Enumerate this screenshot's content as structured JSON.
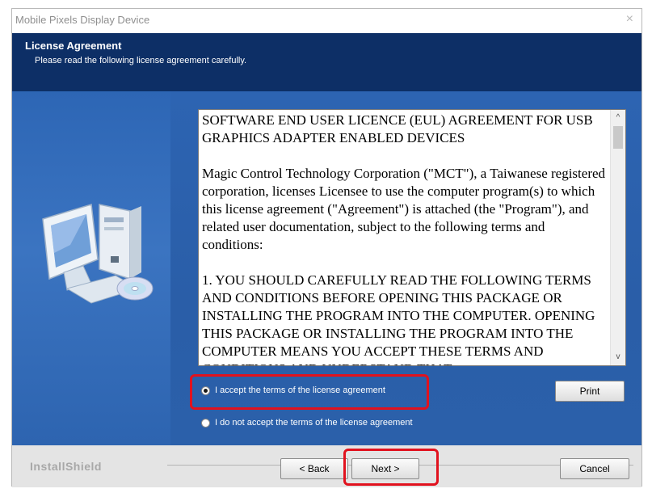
{
  "window": {
    "title": "Mobile Pixels Display Device",
    "close_glyph": "×"
  },
  "header": {
    "title": "License Agreement",
    "subtitle": "Please read the following license agreement carefully."
  },
  "license": {
    "paragraphs": [
      "SOFTWARE END USER LICENCE (EUL) AGREEMENT FOR USB GRAPHICS ADAPTER ENABLED DEVICES",
      "Magic Control Technology Corporation (\"MCT\"), a Taiwanese registered corporation, licenses Licensee to use the computer program(s) to which this license agreement (\"Agreement\") is attached (the \"Program\"), and related user documentation, subject to the following terms and conditions:",
      "1. YOU SHOULD CAREFULLY READ THE FOLLOWING TERMS AND CONDITIONS BEFORE OPENING THIS PACKAGE OR INSTALLING THE PROGRAM INTO THE COMPUTER. OPENING THIS PACKAGE OR INSTALLING THE PROGRAM INTO THE COMPUTER MEANS YOU ACCEPT THESE TERMS AND CONDITIONS AND UNDERSTAND THAT"
    ],
    "scroll_up_glyph": "^",
    "scroll_down_glyph": "v"
  },
  "options": {
    "accept_label": "I accept the terms of the license agreement",
    "decline_label": "I do not accept the terms of the license agreement",
    "selected": "accept"
  },
  "buttons": {
    "print": "Print",
    "back": "< Back",
    "next": "Next >",
    "cancel": "Cancel"
  },
  "footer": {
    "brand": "InstallShield"
  },
  "colors": {
    "header_bg": "#0d2f66",
    "panel_bg": "#2d64b2",
    "highlight": "#e1121e"
  },
  "icons": [
    "computer-cd-icon",
    "close-icon",
    "scroll-up-icon",
    "scroll-down-icon"
  ]
}
